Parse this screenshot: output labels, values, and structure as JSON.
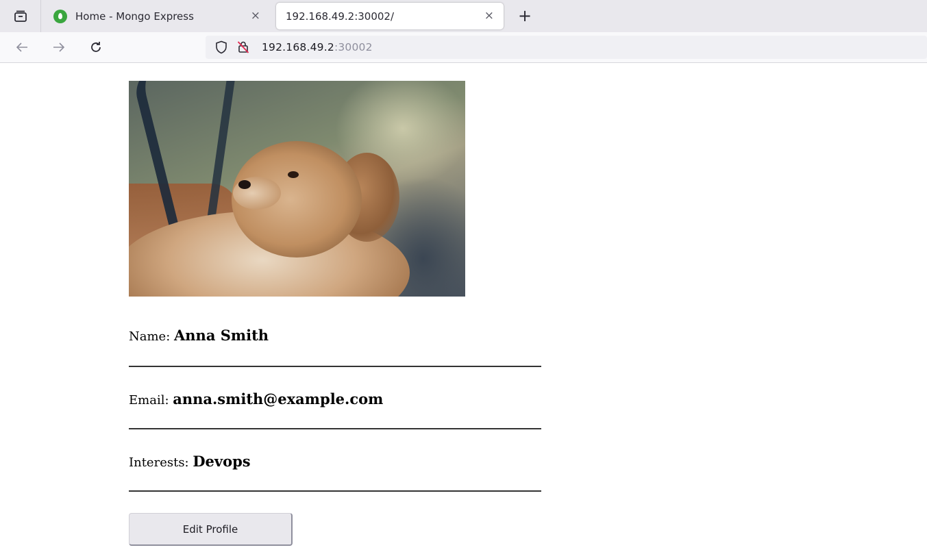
{
  "browser": {
    "tabs": [
      {
        "title": "Home - Mongo Express",
        "active": false
      },
      {
        "title": "192.168.49.2:30002/",
        "active": true
      }
    ],
    "new_tab_label": "+",
    "close_glyph": "×",
    "url_host": "192.168.49.2",
    "url_port": ":30002",
    "icons": {
      "tab_overview": "tab-overview-icon",
      "back": "back-arrow-icon",
      "forward": "forward-arrow-icon",
      "reload": "reload-icon",
      "shield": "tracking-protection-shield-icon",
      "insecure": "insecure-connection-lock-icon",
      "favicon": "mongo-leaf-favicon"
    }
  },
  "profile": {
    "name_label": "Name: ",
    "name_value": "Anna Smith",
    "email_label": "Email: ",
    "email_value": "anna.smith@example.com",
    "interests_label": "Interests: ",
    "interests_value": "Devops",
    "edit_button_label": "Edit Profile"
  }
}
